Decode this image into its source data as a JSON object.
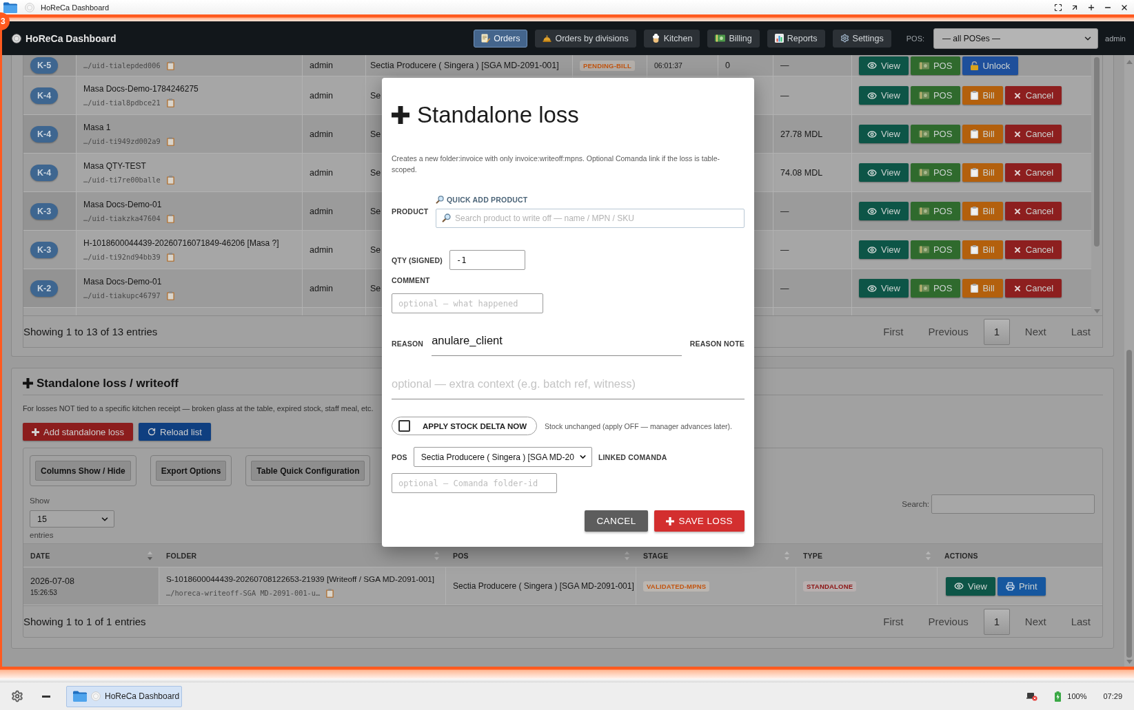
{
  "window": {
    "title": "HoReCa Dashboard",
    "badge": "3"
  },
  "navbar": {
    "brand": "HoReCa Dashboard",
    "items": [
      {
        "label": "Orders",
        "selected": true
      },
      {
        "label": "Orders by divisions",
        "selected": false
      },
      {
        "label": "Kitchen",
        "selected": false
      },
      {
        "label": "Billing",
        "selected": false
      },
      {
        "label": "Reports",
        "selected": false
      },
      {
        "label": "Settings",
        "selected": false
      }
    ],
    "pos_label": "POS:",
    "pos_select": "— all POSes —",
    "user": "admin"
  },
  "orders_table": {
    "rows": [
      {
        "badge": "K-5",
        "path": "…/uid-tialepded006",
        "user": "admin",
        "pos": "Sectia Producere ( Singera ) [SGA MD-2091-001]",
        "stage": "PENDING-BILL",
        "time": "06:01:37",
        "count": "0",
        "amount": "—",
        "actions": [
          {
            "label": "View",
            "kind": "view"
          },
          {
            "label": "POS",
            "kind": "pos"
          },
          {
            "label": "Unlock",
            "kind": "unlock"
          }
        ]
      },
      {
        "badge": "K-4",
        "name": "Masa Docs-Demo-1784246275",
        "path": "…/uid-tial8pdbce21",
        "user": "admin",
        "pos": "Se",
        "amount": "—",
        "actions": [
          {
            "label": "View",
            "kind": "view"
          },
          {
            "label": "POS",
            "kind": "pos"
          },
          {
            "label": "Bill",
            "kind": "bill"
          },
          {
            "label": "Cancel",
            "kind": "cancel"
          }
        ]
      },
      {
        "badge": "K-4",
        "name": "Masa 1",
        "path": "…/uid-ti949zd002a9",
        "user": "admin",
        "pos": "Se",
        "amount": "27.78 MDL",
        "actions": [
          {
            "label": "View",
            "kind": "view"
          },
          {
            "label": "POS",
            "kind": "pos"
          },
          {
            "label": "Bill",
            "kind": "bill"
          },
          {
            "label": "Cancel",
            "kind": "cancel"
          }
        ]
      },
      {
        "badge": "K-4",
        "name": "Masa QTY-TEST",
        "path": "…/uid-ti7re00balle",
        "user": "admin",
        "pos": "Se",
        "amount": "74.08 MDL",
        "actions": [
          {
            "label": "View",
            "kind": "view"
          },
          {
            "label": "POS",
            "kind": "pos"
          },
          {
            "label": "Bill",
            "kind": "bill"
          },
          {
            "label": "Cancel",
            "kind": "cancel"
          }
        ]
      },
      {
        "badge": "K-3",
        "name": "Masa Docs-Demo-01",
        "path": "…/uid-tiakzka47604",
        "user": "admin",
        "pos": "Se",
        "amount": "—",
        "actions": [
          {
            "label": "View",
            "kind": "view"
          },
          {
            "label": "POS",
            "kind": "pos"
          },
          {
            "label": "Bill",
            "kind": "bill"
          },
          {
            "label": "Cancel",
            "kind": "cancel"
          }
        ]
      },
      {
        "badge": "K-3",
        "name": "H-1018600044439-20260716071849-46206 [Masa ?]",
        "path": "…/uid-ti92nd94bb39",
        "user": "admin",
        "pos": "Se",
        "amount": "—",
        "actions": [
          {
            "label": "View",
            "kind": "view"
          },
          {
            "label": "POS",
            "kind": "pos"
          },
          {
            "label": "Bill",
            "kind": "bill"
          },
          {
            "label": "Cancel",
            "kind": "cancel"
          }
        ]
      },
      {
        "badge": "K-2",
        "name": "Masa Docs-Demo-01",
        "path": "…/uid-tiakupc46797",
        "user": "admin",
        "pos": "Se",
        "amount": "—",
        "actions": [
          {
            "label": "View",
            "kind": "view"
          },
          {
            "label": "POS",
            "kind": "pos"
          },
          {
            "label": "Bill",
            "kind": "bill"
          },
          {
            "label": "Cancel",
            "kind": "cancel"
          }
        ]
      }
    ],
    "summary": "Showing 1 to 13 of 13 entries",
    "pagination": [
      {
        "label": "First",
        "selected": false
      },
      {
        "label": "Previous",
        "selected": false
      },
      {
        "label": "1",
        "selected": true
      },
      {
        "label": "Next",
        "selected": false
      },
      {
        "label": "Last",
        "selected": false
      }
    ]
  },
  "writeoff_section": {
    "title": "Standalone loss / writeoff",
    "description": "For losses NOT tied to a specific kitchen receipt — broken glass at the table, expired stock, staff meal, etc.",
    "buttons": [
      {
        "label": "Add standalone loss",
        "kind": "add"
      },
      {
        "label": "Reload list",
        "kind": "reload"
      }
    ],
    "toolbar": [
      "Columns Show / Hide",
      "Export Options",
      "Table Quick Configuration"
    ],
    "show_label": "Show",
    "page_size": "15",
    "entries_label": "entries",
    "search_label": "Search:",
    "columns": [
      {
        "label": "DATE",
        "sorted": true
      },
      {
        "label": "FOLDER",
        "sorted": false
      },
      {
        "label": "POS",
        "sorted": false
      },
      {
        "label": "STAGE",
        "sorted": false
      },
      {
        "label": "TYPE",
        "sorted": false
      },
      {
        "label": "ACTIONS"
      }
    ],
    "rows": [
      {
        "date": "2026-07-08",
        "time": "15:26:53",
        "folder": "S-1018600044439-20260708122653-21939 [Writeoff / SGA MD-2091-001]",
        "path": "…/horeca-writeoff-SGA MD-2091-001-u…",
        "pos": "Sectia Producere ( Singera ) [SGA MD-2091-001]",
        "stage": "VALIDATED-MPNS",
        "type": "STANDALONE",
        "actions": [
          {
            "label": "View",
            "kind": "view"
          },
          {
            "label": "Print",
            "kind": "print"
          }
        ]
      }
    ],
    "summary": "Showing 1 to 1 of 1 entries",
    "pagination": [
      {
        "label": "First",
        "selected": false
      },
      {
        "label": "Previous",
        "selected": false
      },
      {
        "label": "1",
        "selected": true
      },
      {
        "label": "Next",
        "selected": false
      },
      {
        "label": "Last",
        "selected": false
      }
    ]
  },
  "modal": {
    "title": "Standalone loss",
    "description": "Creates a new folder:invoice with only invoice:writeoff:mpns. Optional Comanda link if the loss is table-scoped.",
    "quick_add": "QUICK ADD PRODUCT",
    "product": {
      "label": "PRODUCT",
      "placeholder": "Search product to write off — name / MPN / SKU"
    },
    "qty": {
      "label": "QTY (SIGNED)",
      "value": "-1"
    },
    "comment": {
      "label": "COMMENT",
      "placeholder": "optional — what happened"
    },
    "reason": {
      "label": "REASON",
      "value": "anulare_client"
    },
    "reason_note": {
      "label": "REASON NOTE",
      "placeholder": "optional — extra context (e.g. batch ref, witness)"
    },
    "apply_stock_delta": {
      "label": "APPLY STOCK DELTA NOW",
      "checked": false,
      "hint": "Stock unchanged (apply OFF — manager advances later)."
    },
    "pos": {
      "label": "POS",
      "value": "Sectia Producere ( Singera ) [SGA MD-20"
    },
    "linked_comanda": {
      "label": "LINKED COMANDA",
      "placeholder": "optional — Comanda folder-id"
    },
    "buttons": [
      {
        "label": "CANCEL",
        "kind": "secondary"
      },
      {
        "label": "SAVE LOSS",
        "kind": "primary"
      }
    ]
  },
  "taskbar": {
    "task": "HoReCa Dashboard",
    "battery": "100%",
    "clock": "07:29"
  }
}
